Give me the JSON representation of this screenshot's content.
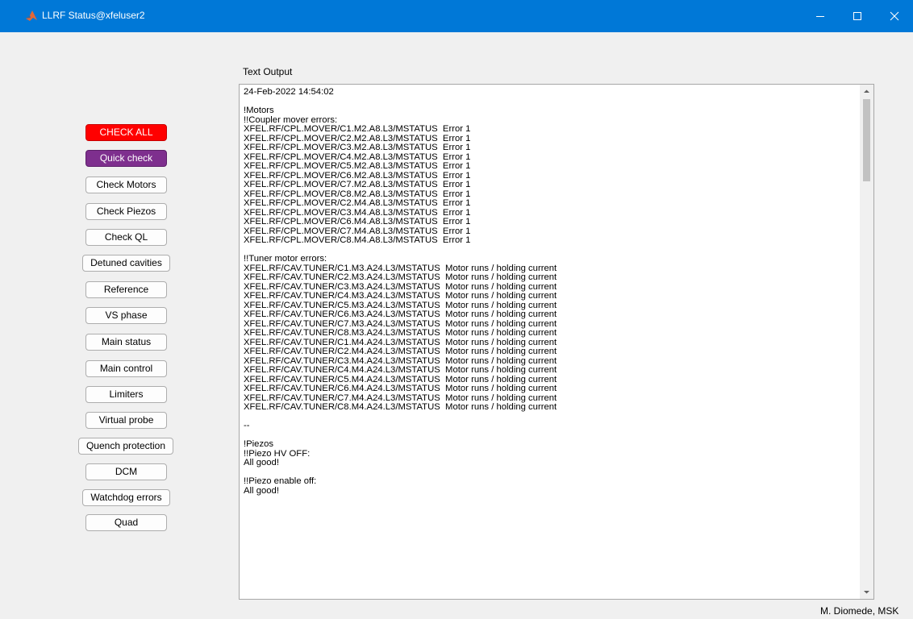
{
  "window": {
    "title": "LLRF Status@xfeluser2",
    "icons": [
      "matlab-icon",
      "minimize-icon",
      "maximize-icon",
      "close-icon"
    ]
  },
  "sidebar": {
    "buttons": [
      {
        "label": "CHECK ALL",
        "color": "#ff0000"
      },
      {
        "label": "Quick check",
        "color": "#7e2f8e"
      },
      {
        "label": "Check Motors"
      },
      {
        "label": "Check Piezos"
      },
      {
        "label": "Check QL"
      },
      {
        "label": "Detuned cavities"
      },
      {
        "label": "Reference"
      },
      {
        "label": "VS phase"
      },
      {
        "label": "Main status"
      },
      {
        "label": "Main control"
      },
      {
        "label": "Limiters"
      },
      {
        "label": "Virtual probe"
      },
      {
        "label": "Quench protection"
      },
      {
        "label": "DCM"
      },
      {
        "label": "Watchdog errors"
      },
      {
        "label": "Quad"
      }
    ]
  },
  "output": {
    "label": "Text Output",
    "text": "24-Feb-2022 14:54:02\n\n!Motors\n!!Coupler mover errors:\nXFEL.RF/CPL.MOVER/C1.M2.A8.L3/MSTATUS  Error 1\nXFEL.RF/CPL.MOVER/C2.M2.A8.L3/MSTATUS  Error 1\nXFEL.RF/CPL.MOVER/C3.M2.A8.L3/MSTATUS  Error 1\nXFEL.RF/CPL.MOVER/C4.M2.A8.L3/MSTATUS  Error 1\nXFEL.RF/CPL.MOVER/C5.M2.A8.L3/MSTATUS  Error 1\nXFEL.RF/CPL.MOVER/C6.M2.A8.L3/MSTATUS  Error 1\nXFEL.RF/CPL.MOVER/C7.M2.A8.L3/MSTATUS  Error 1\nXFEL.RF/CPL.MOVER/C8.M2.A8.L3/MSTATUS  Error 1\nXFEL.RF/CPL.MOVER/C2.M4.A8.L3/MSTATUS  Error 1\nXFEL.RF/CPL.MOVER/C3.M4.A8.L3/MSTATUS  Error 1\nXFEL.RF/CPL.MOVER/C6.M4.A8.L3/MSTATUS  Error 1\nXFEL.RF/CPL.MOVER/C7.M4.A8.L3/MSTATUS  Error 1\nXFEL.RF/CPL.MOVER/C8.M4.A8.L3/MSTATUS  Error 1\n\n!!Tuner motor errors:\nXFEL.RF/CAV.TUNER/C1.M3.A24.L3/MSTATUS  Motor runs / holding current\nXFEL.RF/CAV.TUNER/C2.M3.A24.L3/MSTATUS  Motor runs / holding current\nXFEL.RF/CAV.TUNER/C3.M3.A24.L3/MSTATUS  Motor runs / holding current\nXFEL.RF/CAV.TUNER/C4.M3.A24.L3/MSTATUS  Motor runs / holding current\nXFEL.RF/CAV.TUNER/C5.M3.A24.L3/MSTATUS  Motor runs / holding current\nXFEL.RF/CAV.TUNER/C6.M3.A24.L3/MSTATUS  Motor runs / holding current\nXFEL.RF/CAV.TUNER/C7.M3.A24.L3/MSTATUS  Motor runs / holding current\nXFEL.RF/CAV.TUNER/C8.M3.A24.L3/MSTATUS  Motor runs / holding current\nXFEL.RF/CAV.TUNER/C1.M4.A24.L3/MSTATUS  Motor runs / holding current\nXFEL.RF/CAV.TUNER/C2.M4.A24.L3/MSTATUS  Motor runs / holding current\nXFEL.RF/CAV.TUNER/C3.M4.A24.L3/MSTATUS  Motor runs / holding current\nXFEL.RF/CAV.TUNER/C4.M4.A24.L3/MSTATUS  Motor runs / holding current\nXFEL.RF/CAV.TUNER/C5.M4.A24.L3/MSTATUS  Motor runs / holding current\nXFEL.RF/CAV.TUNER/C6.M4.A24.L3/MSTATUS  Motor runs / holding current\nXFEL.RF/CAV.TUNER/C7.M4.A24.L3/MSTATUS  Motor runs / holding current\nXFEL.RF/CAV.TUNER/C8.M4.A24.L3/MSTATUS  Motor runs / holding current\n\n--\n\n!Piezos\n!!Piezo HV OFF:\nAll good!\n\n!!Piezo enable off:\nAll good!"
  },
  "footer": {
    "credit": "M. Diomede, MSK"
  }
}
